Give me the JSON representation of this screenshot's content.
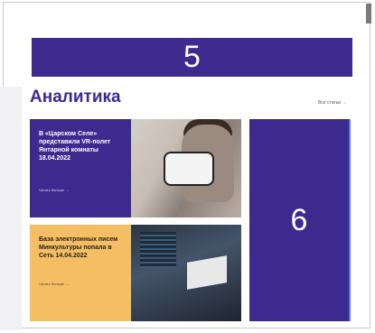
{
  "banner_top": {
    "label": "5"
  },
  "section": {
    "title": "Аналитика",
    "all_link": "Все статьи →"
  },
  "cards": [
    {
      "headline": "В «Царском Селе» представили VR-полет Янтарной комнаты 18.04.2022",
      "read_more": "Читать больше →"
    },
    {
      "headline": "База электронных писем Минкультуры попала в Сеть 14.04.2022",
      "read_more": "Читать больше →"
    }
  ],
  "side_block": {
    "label": "6"
  },
  "colors": {
    "brand_purple": "#3c2a8e",
    "accent_yellow": "#f6be62"
  }
}
